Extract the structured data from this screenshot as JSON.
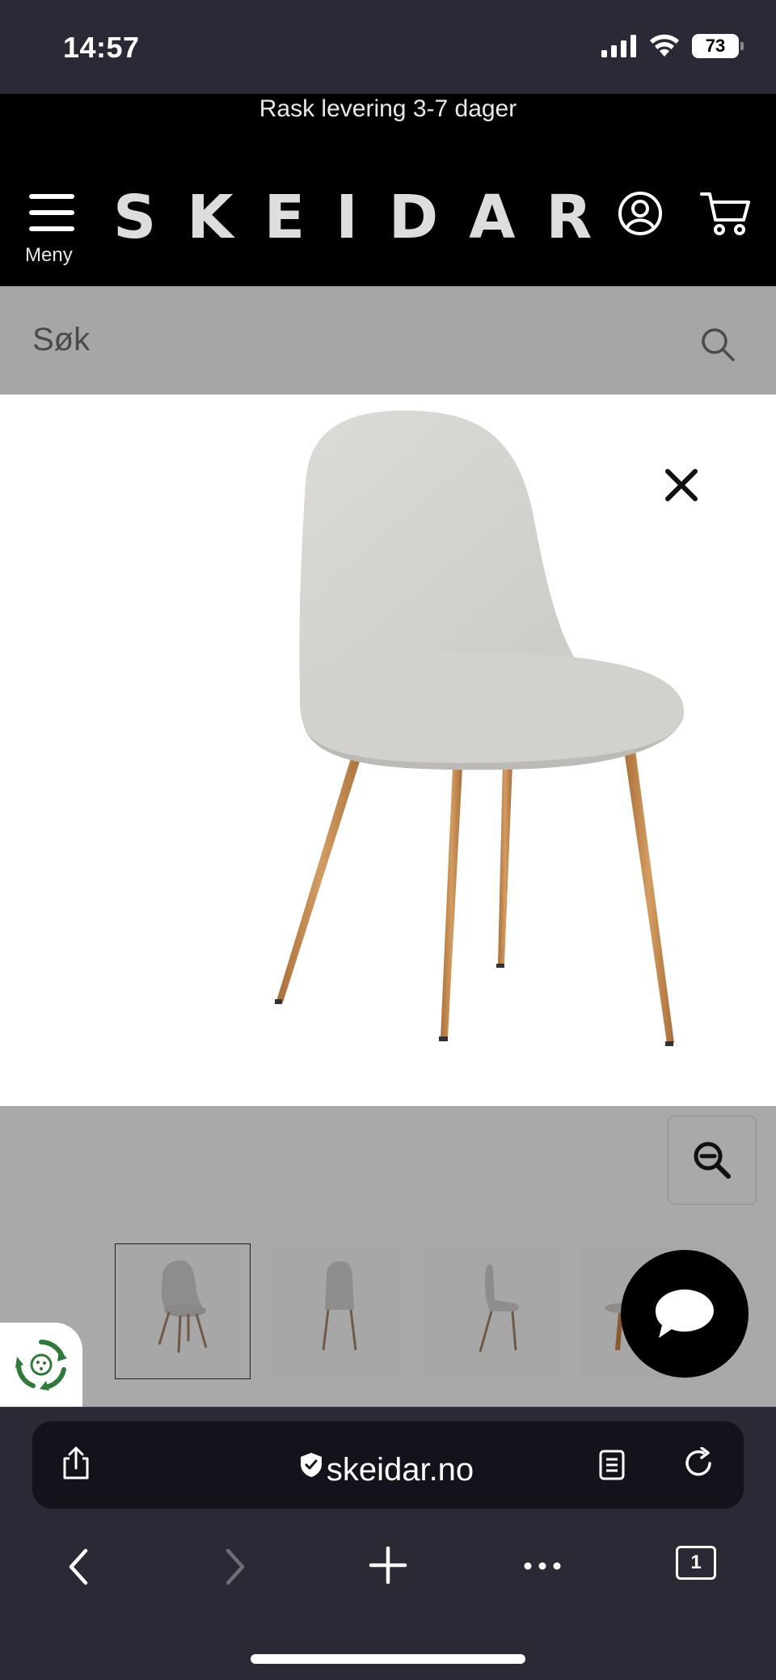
{
  "status_bar": {
    "time": "14:57",
    "battery": "73"
  },
  "header": {
    "promo": "Rask levering 3-7 dager",
    "logo": "SKEIDAR",
    "menu_label": "Meny"
  },
  "search": {
    "placeholder": "Søk"
  },
  "gallery": {
    "thumbnails": [
      "front",
      "back",
      "side",
      "detail"
    ]
  },
  "browser": {
    "url": "skeidar.no",
    "tabs_count": "1"
  },
  "colors": {
    "header_bg": "#000000",
    "overlay_gray": "#a9a9a9",
    "browser_bg": "#2a2935",
    "leg_wood": "#c48a4f",
    "fabric": "#d6d4d2",
    "eco_green": "#2f7a3a"
  }
}
